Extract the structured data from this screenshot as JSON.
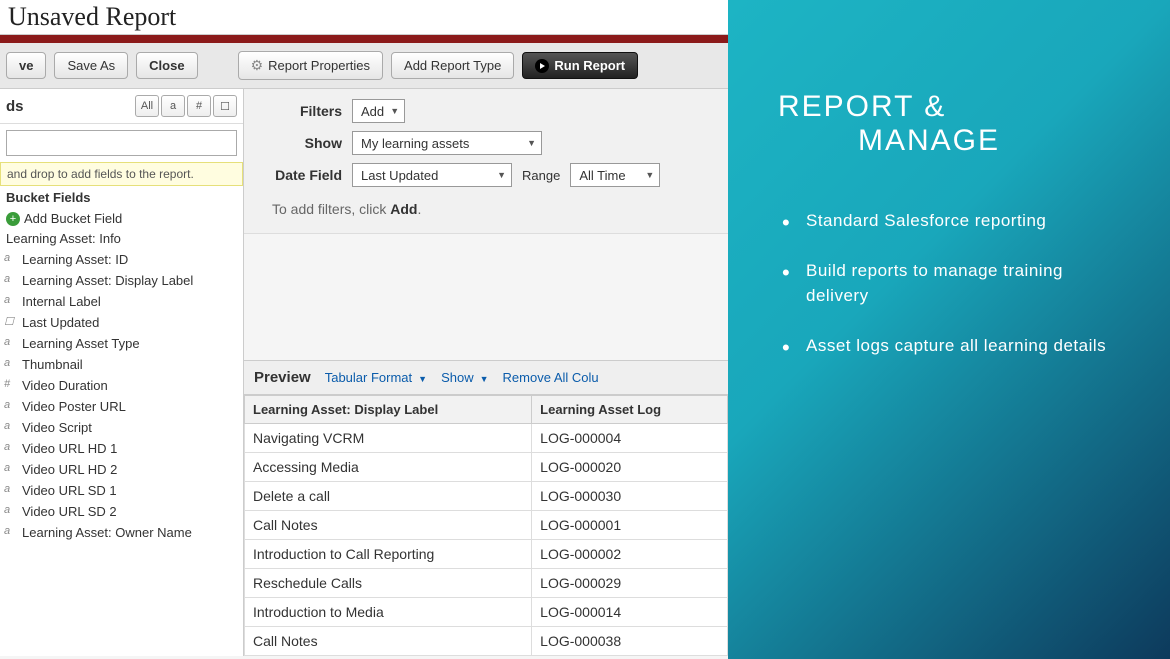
{
  "header": {
    "title": "Unsaved Report"
  },
  "toolbar": {
    "save": "ve",
    "saveAs": "Save As",
    "close": "Close",
    "reportProps": "Report Properties",
    "addReportType": "Add Report Type",
    "runReport": "Run Report"
  },
  "sidebar": {
    "title": "ds",
    "miniBtns": [
      "All",
      "a",
      "#",
      "☐"
    ],
    "dragHint": "and drop to add fields to the report.",
    "bucketTitle": "Bucket Fields",
    "addBucket": "Add Bucket Field",
    "groupTitle": "Learning Asset: Info",
    "fields": [
      {
        "icon": "a",
        "label": "Learning Asset: ID"
      },
      {
        "icon": "a",
        "label": "Learning Asset: Display Label"
      },
      {
        "icon": "a",
        "label": "Internal Label"
      },
      {
        "icon": "☐",
        "label": "Last Updated"
      },
      {
        "icon": "a",
        "label": "Learning Asset Type"
      },
      {
        "icon": "a",
        "label": "Thumbnail"
      },
      {
        "icon": "#",
        "label": "Video Duration"
      },
      {
        "icon": "a",
        "label": "Video Poster URL"
      },
      {
        "icon": "a",
        "label": "Video Script"
      },
      {
        "icon": "a",
        "label": "Video URL HD 1"
      },
      {
        "icon": "a",
        "label": "Video URL HD 2"
      },
      {
        "icon": "a",
        "label": "Video URL SD 1"
      },
      {
        "icon": "a",
        "label": "Video URL SD 2"
      },
      {
        "icon": "a",
        "label": "Learning Asset: Owner Name"
      }
    ]
  },
  "filters": {
    "filtersLabel": "Filters",
    "addBtn": "Add",
    "showLabel": "Show",
    "showValue": "My learning assets",
    "dateLabel": "Date Field",
    "dateValue": "Last Updated",
    "rangeLabel": "Range",
    "rangeValue": "All Time",
    "hintPrefix": "To add filters, click ",
    "hintBold": "Add"
  },
  "preview": {
    "title": "Preview",
    "formatLink": "Tabular Format",
    "showLink": "Show",
    "removeAll": "Remove All Colu",
    "col1": "Learning Asset: Display Label",
    "col2": "Learning Asset Log",
    "rows": [
      {
        "c1": "Navigating VCRM",
        "c2": "LOG-000004"
      },
      {
        "c1": "Accessing Media",
        "c2": "LOG-000020"
      },
      {
        "c1": "Delete a call",
        "c2": "LOG-000030"
      },
      {
        "c1": "Call Notes",
        "c2": "LOG-000001"
      },
      {
        "c1": "Introduction to Call Reporting",
        "c2": "LOG-000002"
      },
      {
        "c1": "Reschedule Calls",
        "c2": "LOG-000029"
      },
      {
        "c1": "Introduction to Media",
        "c2": "LOG-000014"
      },
      {
        "c1": "Call Notes",
        "c2": "LOG-000038"
      }
    ]
  },
  "slide": {
    "titleL1": "REPORT &",
    "titleL2": "MANAGE",
    "bullets": [
      "Standard Salesforce reporting",
      "Build reports to manage training delivery",
      "Asset logs capture all learning details"
    ]
  }
}
